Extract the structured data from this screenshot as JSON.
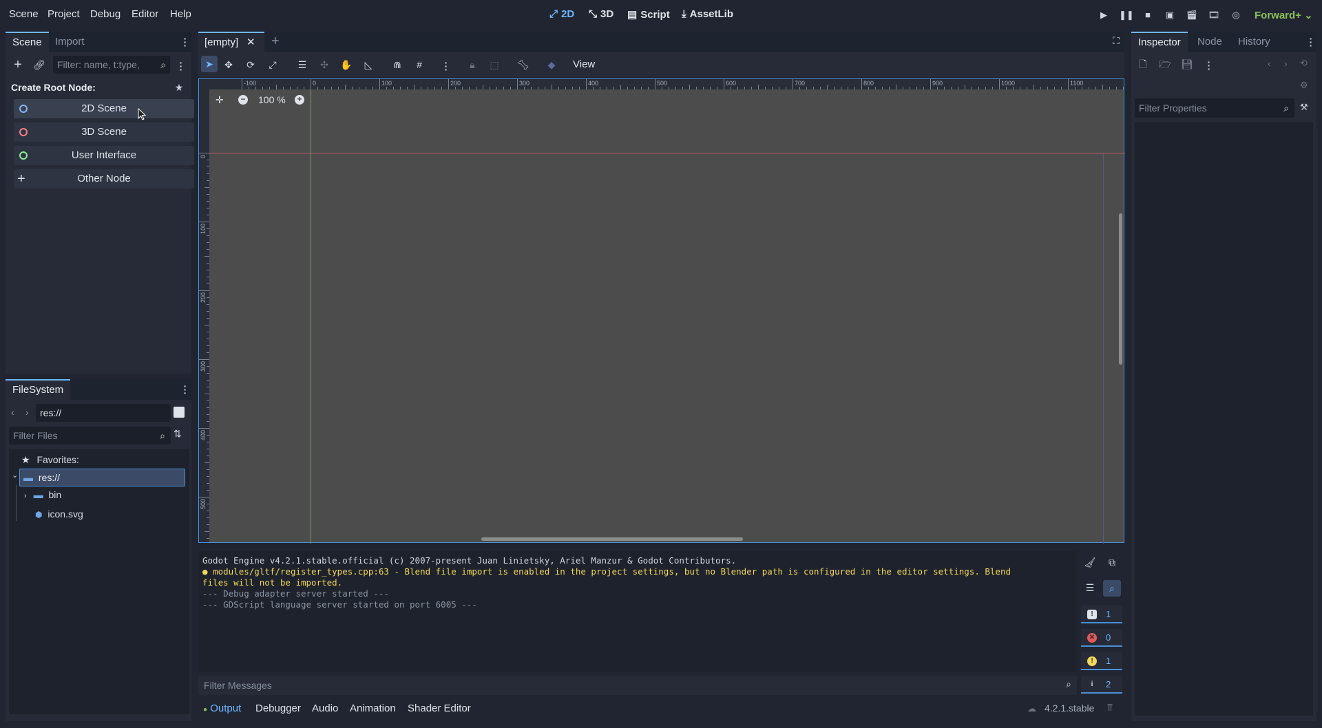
{
  "menu": [
    "Scene",
    "Project",
    "Debug",
    "Editor",
    "Help"
  ],
  "main_screens": [
    {
      "label": "2D",
      "icon": "2d-icon",
      "active": true
    },
    {
      "label": "3D",
      "icon": "3d-icon",
      "active": false
    },
    {
      "label": "Script",
      "icon": "script-icon",
      "active": false
    },
    {
      "label": "AssetLib",
      "icon": "assetlib-icon",
      "active": false
    }
  ],
  "renderer": "Forward+",
  "colors": {
    "accent": "#70b8ff",
    "renderer": "#8fbf5a",
    "warning": "#f2d85a",
    "error": "#e35a5a"
  },
  "scene_dock": {
    "tabs": [
      "Scene",
      "Import"
    ],
    "filter_placeholder": "Filter: name, t:type,",
    "create_root_title": "Create Root Node:",
    "root_options": [
      {
        "label": "2D Scene",
        "color": "#8ab4f8"
      },
      {
        "label": "3D Scene",
        "color": "#fc7f7f"
      },
      {
        "label": "User Interface",
        "color": "#8eef97"
      },
      {
        "label": "Other Node",
        "color": "#dfe3ea"
      }
    ]
  },
  "filesystem": {
    "tab": "FileSystem",
    "path": "res://",
    "filter_placeholder": "Filter Files",
    "favorites": "Favorites:",
    "root": "res://",
    "items": [
      "bin",
      "icon.svg"
    ]
  },
  "editor": {
    "tab": "[empty]",
    "view_menu": "View",
    "zoom": "100 %",
    "ruler_h": [
      "-100",
      "0",
      "100",
      "200",
      "300",
      "400",
      "500",
      "600",
      "700",
      "800",
      "900",
      "1000",
      "1100"
    ],
    "ruler_v": [
      "0",
      "100",
      "200",
      "300",
      "400",
      "500"
    ]
  },
  "inspector": {
    "tabs": [
      "Inspector",
      "Node",
      "History"
    ],
    "filter_placeholder": "Filter Properties"
  },
  "output": {
    "lines": [
      {
        "text": "Godot Engine v4.2.1.stable.official (c) 2007-present Juan Linietsky, Ariel Manzur & Godot Contributors.",
        "kind": "normal"
      },
      {
        "text": "modules/gltf/register_types.cpp:63 - Blend file import is enabled in the project settings, but no Blender path is configured in the editor settings. Blend",
        "kind": "warning"
      },
      {
        "text": "files will not be imported.",
        "kind": "warning-cont"
      },
      {
        "text": "--- Debug adapter server started ---",
        "kind": "dim"
      },
      {
        "text": "--- GDScript language server started on port 6005 ---",
        "kind": "dim"
      }
    ],
    "filter_placeholder": "Filter Messages",
    "counts": {
      "messages": "1",
      "errors": "0",
      "warnings": "1",
      "editor": "2"
    }
  },
  "bottom_tabs": [
    "Output",
    "Debugger",
    "Audio",
    "Animation",
    "Shader Editor"
  ],
  "version": "4.2.1.stable"
}
